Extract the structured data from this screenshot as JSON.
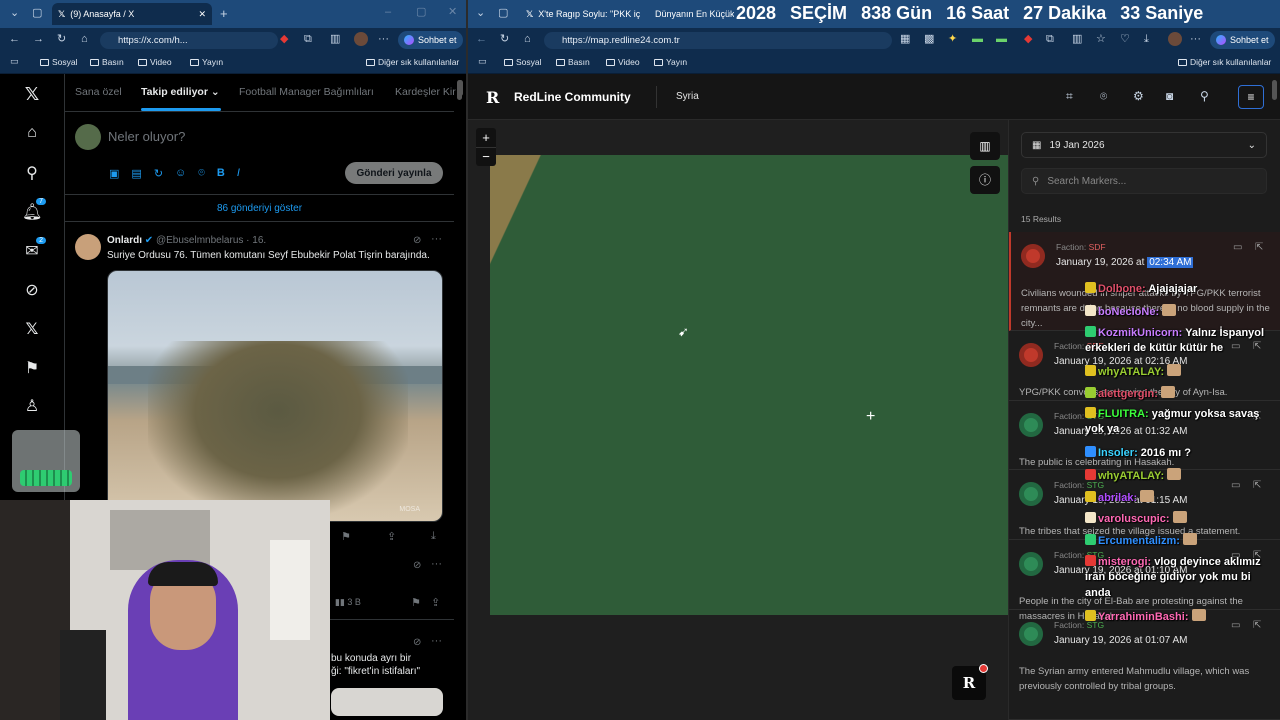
{
  "left_window": {
    "tab_title": "(9) Anasayfa / X",
    "address": "https://x.com/h...",
    "chat_button": "Sohbet et",
    "bookmarks": [
      "Sosyal",
      "Basın",
      "Video",
      "Yayın"
    ],
    "other_bookmarks": "Diğer sık kullanılanlar",
    "x": {
      "tabs": [
        "Sana özel",
        "Takip ediliyor",
        "Football Manager Bağımlıları",
        "Kardeşler Kir"
      ],
      "compose_placeholder": "Neler oluyor?",
      "post_button": "Gönderi yayınla",
      "show_posts": "86 gönderiyi göster",
      "notif_count": "7",
      "msg_count": "2",
      "tweet": {
        "name": "Onlardı",
        "handle": "@Ebuselmnbelarus · 16.",
        "text": "Suriye Ordusu 76. Tümen komutanı Seyf Ebubekir Polat Tişrin barajında.",
        "watermark": "MOSA"
      },
      "views": "3 B",
      "tweet2_text_1": "bu konuda ayrı bir",
      "tweet2_text_2": "ği: \"fikret'in istifaları\""
    }
  },
  "right_window": {
    "tabs": [
      "X'te Ragıp Soylu: \"PKK iç",
      "Dünyanın En Küçük"
    ],
    "countdown": {
      "year": "2028",
      "label": "SEÇİM",
      "days": "838 Gün",
      "hours": "16 Saat",
      "minutes": "27 Dakika",
      "seconds": "33 Saniye"
    },
    "address": "https://map.redline24.com.tr",
    "chat_button": "Sohbet et",
    "bookmarks": [
      "Sosyal",
      "Basın",
      "Video",
      "Yayın"
    ],
    "other_bookmarks": "Diğer sık kullanılanlar"
  },
  "redline": {
    "logo_letter": "R",
    "brand": "RedLine Community",
    "region": "Syria",
    "date": "19 Jan 2026",
    "search_placeholder": "Search Markers...",
    "results": "15 Results",
    "map": {
      "zoom_in": "+",
      "zoom_out": "−",
      "land_color": "#2f5c38",
      "edge_color": "#8a7a4a"
    },
    "markers": [
      {
        "faction": "SDF",
        "date_prefix": "January 19, 2026 at",
        "time": "02:34 AM",
        "text": "Civilians wounded in sniper attacks by YPG/PKK terrorist remnants are dying because there is no blood supply in the city...",
        "color": "#c0392b",
        "label_color": "#e06060"
      },
      {
        "faction": "SDF",
        "date_prefix": "January 19, 2026 at",
        "time": "02:16 AM",
        "text": "YPG/PKK convoys are leaving the city of Ayn-Isa.",
        "color": "#c0392b",
        "label_color": "#e06060"
      },
      {
        "faction": "STG",
        "date_prefix": "January 19, 2026 at",
        "time": "01:32 AM",
        "text": "The public is celebrating in Hasakah.",
        "color": "#2e8b57",
        "label_color": "#4caf50"
      },
      {
        "faction": "STG",
        "date_prefix": "January 19, 2026 at",
        "time": "01:15 AM",
        "text": "The tribes that seized the village issued a statement.",
        "color": "#2e8b57",
        "label_color": "#4caf50"
      },
      {
        "faction": "STG",
        "date_prefix": "January 19, 2026 at",
        "time": "01:10 AM",
        "text": "People in the city of El-Bab are protesting against the massacres in Hasakah.",
        "color": "#2e8b57",
        "label_color": "#4caf50"
      },
      {
        "faction": "STG",
        "date_prefix": "January 19, 2026 at",
        "time": "01:07 AM",
        "text": "The Syrian army entered Mahmudlu village, which was previously controlled by tribal groups.",
        "color": "#2e8b57",
        "label_color": "#4caf50"
      }
    ]
  },
  "chat_overlay": [
    {
      "user": "Dolbone:",
      "msg": "Ajajajajar",
      "color": "#e0506a"
    },
    {
      "user": "boNecIoNe:",
      "msg": "",
      "color": "#c77dff"
    },
    {
      "user": "KozmikUnicorn:",
      "msg": "Yalnız İspanyol",
      "color": "#c77dff"
    },
    {
      "user": "",
      "msg": "erkekleri de kütür kütür he",
      "color": "#fff"
    },
    {
      "user": "whyATALAY:",
      "msg": "",
      "color": "#9acd32"
    },
    {
      "user": "alettgergin:",
      "msg": "",
      "color": "#e0506a"
    },
    {
      "user": "FLUITRA:",
      "msg": "yağmur yoksa savaş",
      "color": "#3cff3c"
    },
    {
      "user": "",
      "msg": "yok ya",
      "color": "#fff"
    },
    {
      "user": "Insoler:",
      "msg": "2016 mı ?",
      "color": "#3ad3ff"
    },
    {
      "user": "whyATALAY:",
      "msg": "",
      "color": "#9acd32"
    },
    {
      "user": "abrilak:",
      "msg": "",
      "color": "#b04cff"
    },
    {
      "user": "varoluscupic:",
      "msg": "",
      "color": "#ff69b4"
    },
    {
      "user": "Ercumentalizm:",
      "msg": "",
      "color": "#2f8fff"
    },
    {
      "user": "misterogi:",
      "msg": "vlog deyince aklımız",
      "color": "#ff69b4"
    },
    {
      "user": "",
      "msg": "iran böceğine gidiyor yok mu bi",
      "color": "#fff"
    },
    {
      "user": "",
      "msg": "anda",
      "color": "#fff"
    },
    {
      "user": "YarrahiminBashi:",
      "msg": "",
      "color": "#ff69b4"
    }
  ]
}
